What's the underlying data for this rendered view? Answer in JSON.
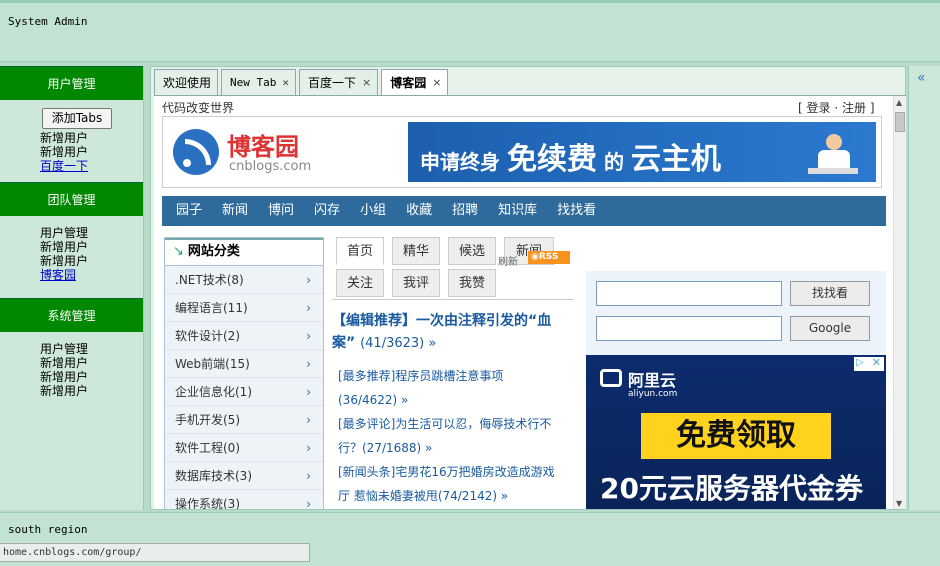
{
  "north": {
    "title": "System Admin"
  },
  "south": {
    "title": "south region"
  },
  "statusbar": {
    "url": "home.cnblogs.com/group/"
  },
  "west": {
    "panels": [
      {
        "title": "用户管理",
        "button": "添加Tabs",
        "items": [
          "新增用户",
          "新增用户"
        ],
        "link": "百度一下"
      },
      {
        "title": "团队管理",
        "items": [
          "用户管理",
          "新增用户",
          "新增用户"
        ],
        "link": "博客园"
      },
      {
        "title": "系统管理",
        "items": [
          "用户管理",
          "新增用户",
          "新增用户",
          "新增用户"
        ]
      }
    ]
  },
  "east": {
    "expand_icon": "«"
  },
  "tabs": [
    {
      "label": "欢迎使用",
      "closable": false
    },
    {
      "label": "New Tab",
      "closable": true
    },
    {
      "label": "百度一下",
      "closable": true
    },
    {
      "label": "博客园",
      "closable": true,
      "active": true
    }
  ],
  "close_glyph": "×",
  "site": {
    "slogan": "代码改变世界",
    "login": "登录",
    "register": "注册",
    "bracket_open": "[",
    "bracket_close": "]",
    "sep": "·",
    "logo_cn": "博客园",
    "logo_en": "cnblogs.com",
    "banner_a": "申请终身",
    "banner_big": "免续费",
    "banner_b": "的",
    "banner_c": "云主机",
    "nav": [
      "园子",
      "新闻",
      "博问",
      "闪存",
      "小组",
      "收藏",
      "招聘",
      "知识库",
      "找找看"
    ],
    "sidebar_title": "网站分类",
    "categories": [
      ".NET技术(8)",
      "编程语言(11)",
      "软件设计(2)",
      "Web前端(15)",
      "企业信息化(1)",
      "手机开发(5)",
      "软件工程(0)",
      "数据库技术(3)",
      "操作系统(3)"
    ],
    "tabs_row1": [
      "首页",
      "精华",
      "候选",
      "新闻"
    ],
    "tabs_row2": [
      "关注",
      "我评",
      "我赞"
    ],
    "refresh": "刷新",
    "rss": "RSS",
    "editor_title": "【编辑推荐】一次由注释引发的“血案”",
    "editor_stat": "(41/3623) »",
    "news": [
      "[最多推荐]程序员跳槽注意事项",
      "(36/4622) »",
      "[最多评论]为生活可以忍，侮辱技术行不",
      "行？(27/1688) »",
      "[新闻头条]宅男花16万把婚房改造成游戏",
      "厅 惹恼未婚妻被甩(74/2142) »"
    ],
    "search_btn": "找找看",
    "google_btn": "Google",
    "ad": {
      "brand_cn": "阿里云",
      "brand_en": "aliyun.com",
      "free": "免费领取",
      "coupon": "20元云服务器代金券"
    }
  }
}
